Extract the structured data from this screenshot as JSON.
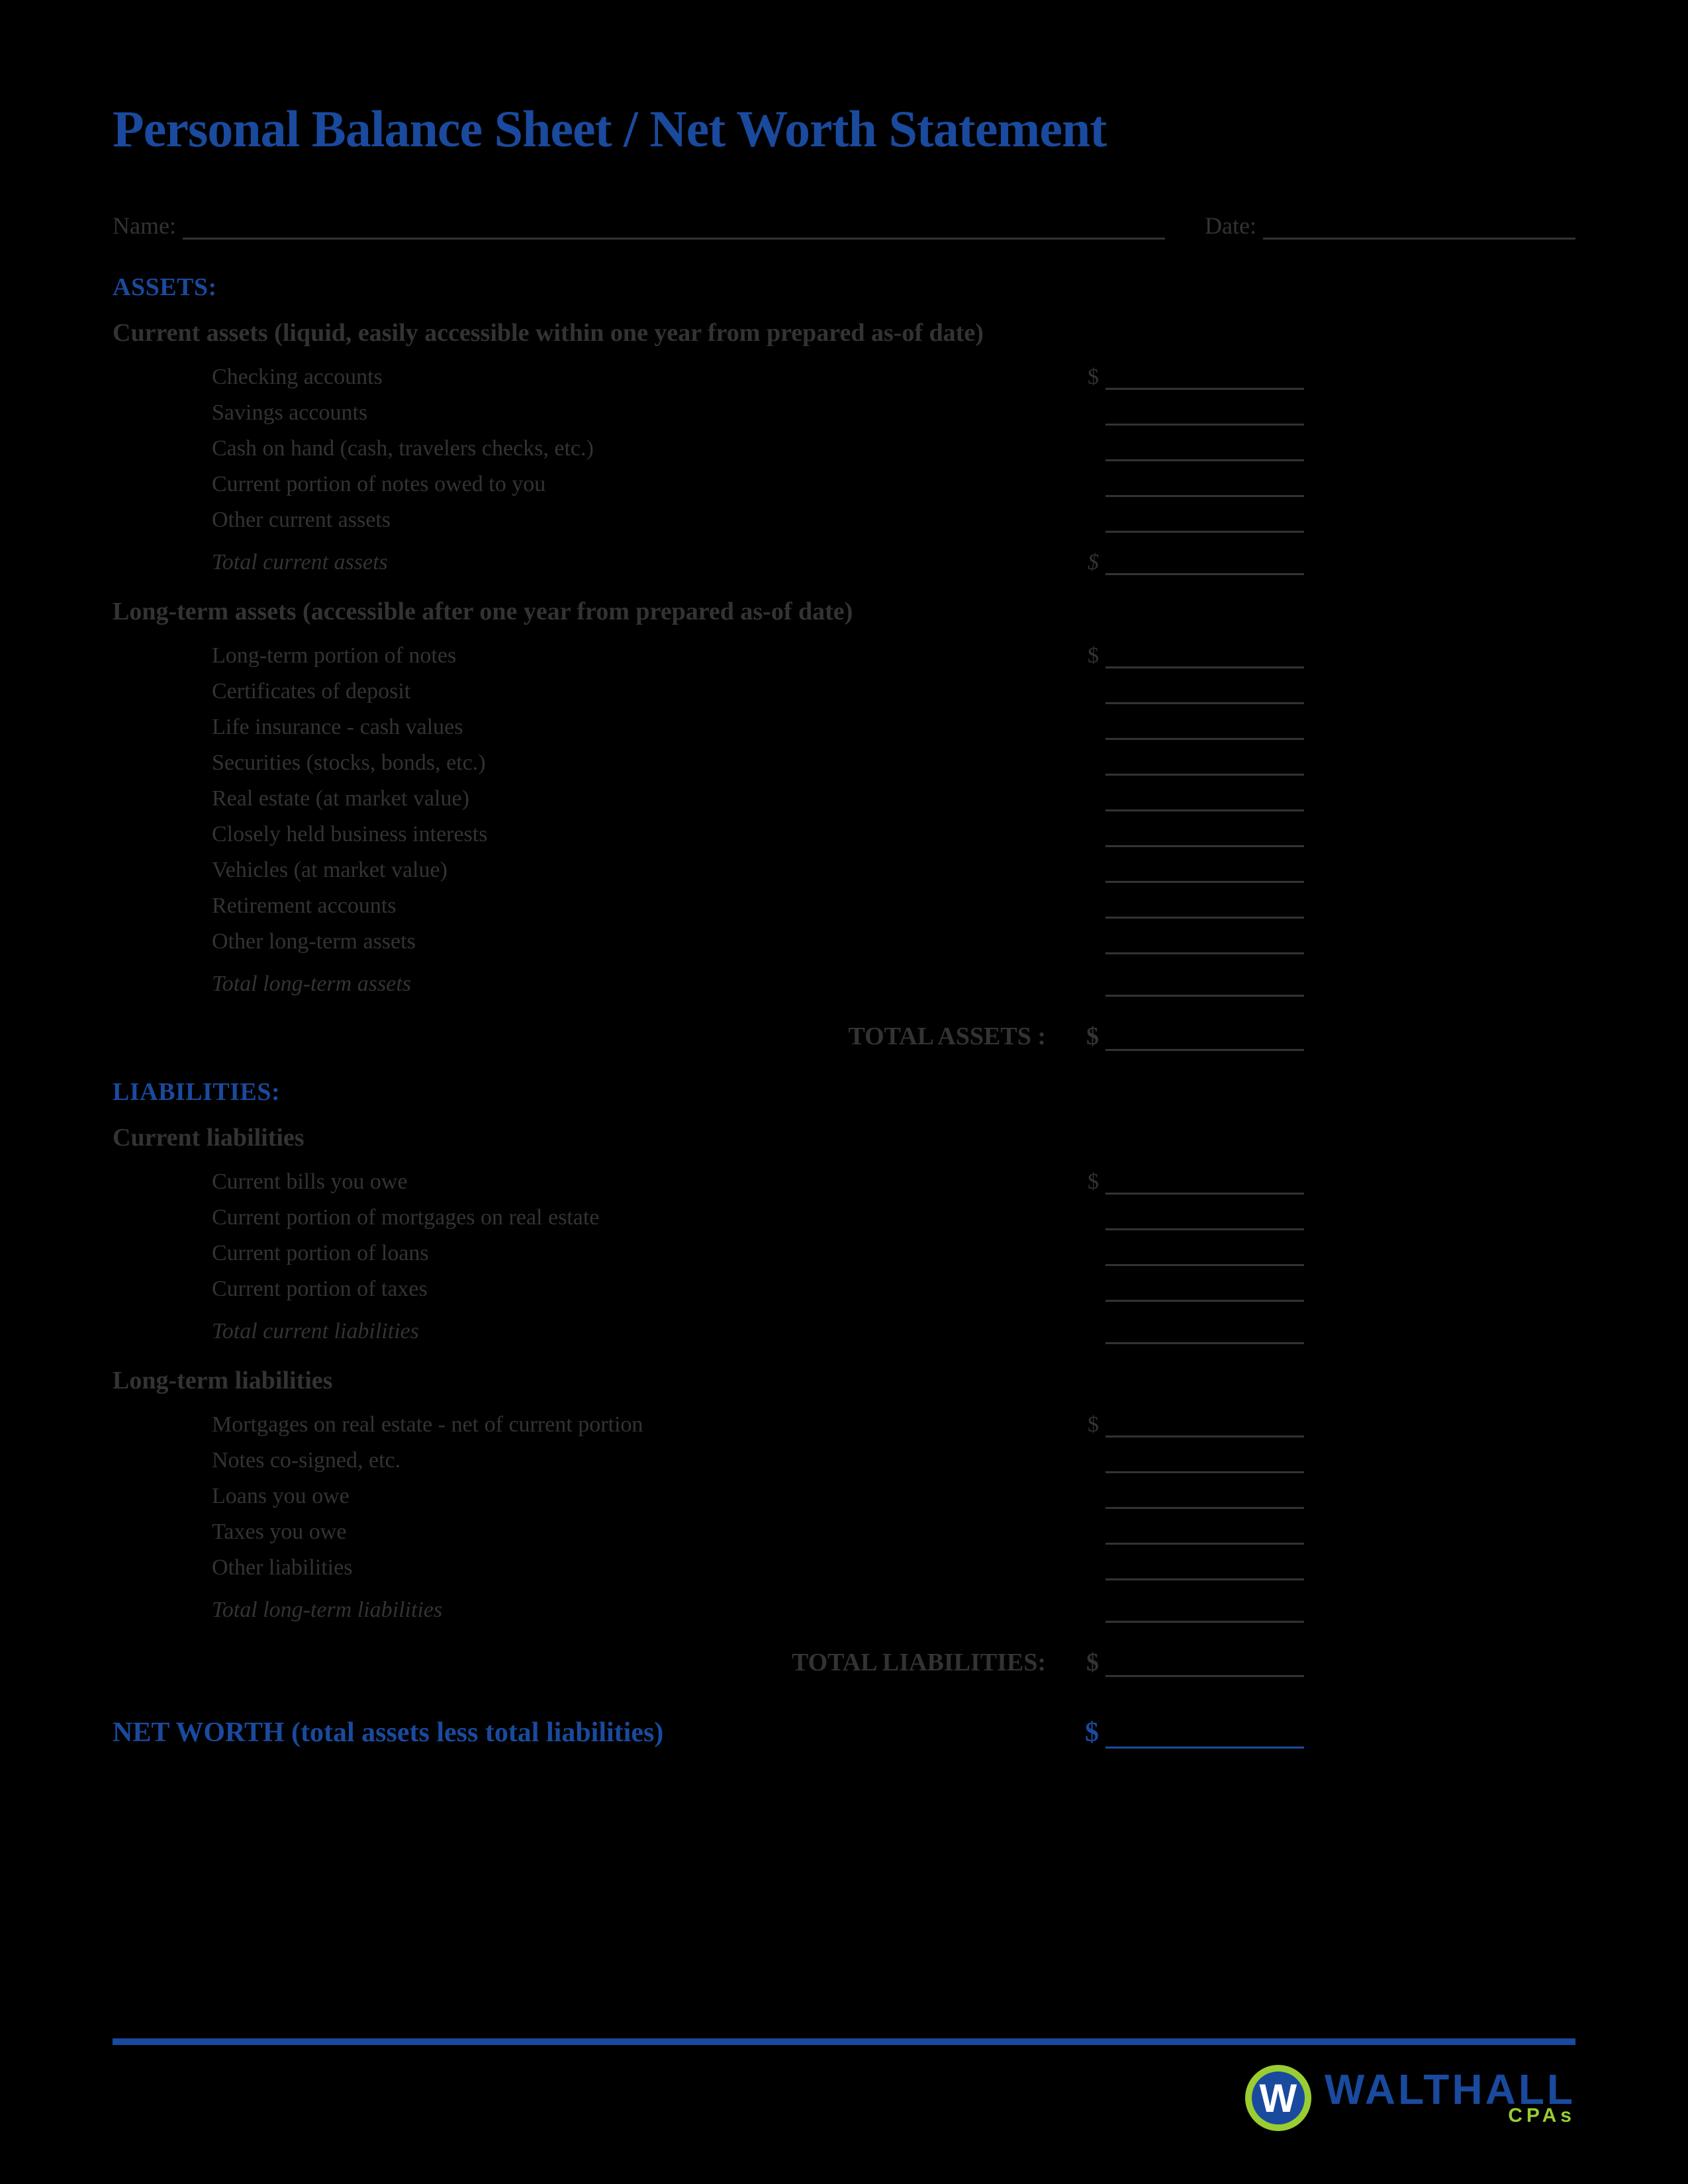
{
  "title": "Personal Balance Sheet / Net Worth Statement",
  "meta": {
    "name_label": "Name:",
    "date_label": "Date:"
  },
  "assets": {
    "header": "ASSETS:",
    "current": {
      "header": "Current assets (liquid, easily accessible within one year from prepared as-of date)",
      "items": [
        "Checking accounts",
        "Savings accounts",
        "Cash on hand (cash, travelers checks, etc.)",
        "Current portion of notes owed to you",
        "Other current assets"
      ],
      "total": "Total current assets"
    },
    "longterm": {
      "header": "Long-term assets (accessible after one year from prepared as-of date)",
      "items": [
        "Long-term portion of notes",
        "Certificates of deposit",
        "Life insurance - cash values",
        "Securities (stocks, bonds, etc.)",
        "Real estate (at market value)",
        "Closely held business interests",
        "Vehicles (at market value)",
        "Retirement accounts",
        "Other long-term assets"
      ],
      "total": "Total long-term assets"
    },
    "grand": "TOTAL ASSETS :"
  },
  "liabilities": {
    "header": "LIABILITIES:",
    "current": {
      "header": "Current liabilities",
      "items": [
        "Current bills you owe",
        "Current portion of mortgages on real estate",
        "Current portion of loans",
        "Current portion of taxes"
      ],
      "total": "Total current liabilities"
    },
    "longterm": {
      "header": "Long-term liabilities",
      "items": [
        "Mortgages on real estate - net of current portion",
        "Notes co-signed, etc.",
        "Loans you owe",
        "Taxes you owe",
        "Other liabilities"
      ],
      "total": "Total long-term liabilities"
    },
    "grand": "TOTAL LIABILITIES:"
  },
  "networth": "NET WORTH (total assets less total liabilities)",
  "dollar": "$",
  "logo": {
    "name": "WALTHALL",
    "sub": "CPAs"
  }
}
